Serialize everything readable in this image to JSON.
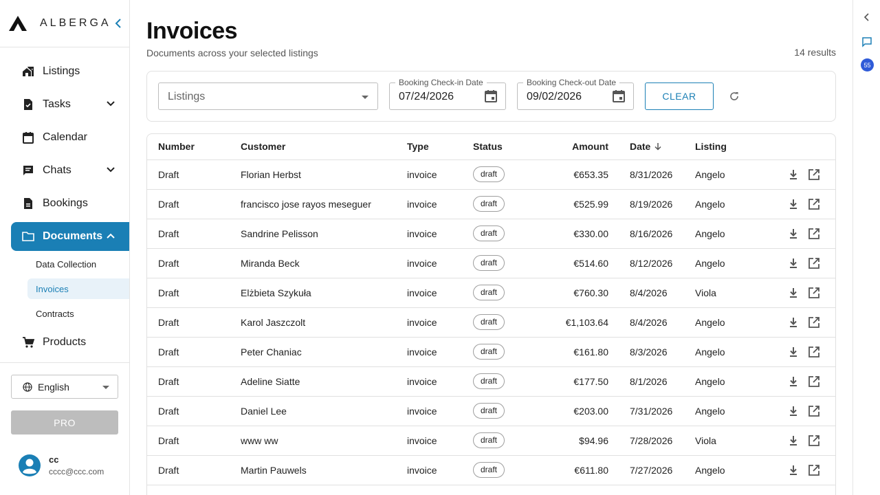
{
  "brand": {
    "name": "ALBERGA"
  },
  "sidebar": {
    "items": [
      {
        "label": "Listings",
        "icon": "home-work-icon"
      },
      {
        "label": "Tasks",
        "icon": "task-icon"
      },
      {
        "label": "Calendar",
        "icon": "calendar-icon"
      },
      {
        "label": "Chats",
        "icon": "chat-icon"
      },
      {
        "label": "Bookings",
        "icon": "document-icon"
      },
      {
        "label": "Documents",
        "icon": "folder-icon",
        "active": true
      },
      {
        "label": "Products",
        "icon": "cart-icon"
      }
    ],
    "documents_sub": [
      {
        "label": "Data Collection"
      },
      {
        "label": "Invoices",
        "active": true
      },
      {
        "label": "Contracts"
      }
    ],
    "language": "English",
    "pro_label": "PRO",
    "user": {
      "name": "cc",
      "email": "cccc@ccc.com"
    }
  },
  "page": {
    "title": "Invoices",
    "subtitle": "Documents across your selected listings",
    "results": "14 results"
  },
  "filters": {
    "listings_placeholder": "Listings",
    "checkin_label": "Booking Check-in Date",
    "checkin_value": "07/24/2026",
    "checkout_label": "Booking Check-out Date",
    "checkout_value": "09/02/2026",
    "clear_label": "CLEAR"
  },
  "table": {
    "headers": {
      "number": "Number",
      "customer": "Customer",
      "type": "Type",
      "status": "Status",
      "amount": "Amount",
      "date": "Date",
      "listing": "Listing"
    },
    "rows": [
      {
        "number": "Draft",
        "customer": "Florian Herbst",
        "type": "invoice",
        "status": "draft",
        "amount": "€653.35",
        "date": "8/31/2026",
        "listing": "Angelo"
      },
      {
        "number": "Draft",
        "customer": "francisco jose rayos meseguer",
        "type": "invoice",
        "status": "draft",
        "amount": "€525.99",
        "date": "8/19/2026",
        "listing": "Angelo"
      },
      {
        "number": "Draft",
        "customer": "Sandrine Pelisson",
        "type": "invoice",
        "status": "draft",
        "amount": "€330.00",
        "date": "8/16/2026",
        "listing": "Angelo"
      },
      {
        "number": "Draft",
        "customer": "Miranda Beck",
        "type": "invoice",
        "status": "draft",
        "amount": "€514.60",
        "date": "8/12/2026",
        "listing": "Angelo"
      },
      {
        "number": "Draft",
        "customer": "Elżbieta Szykuła",
        "type": "invoice",
        "status": "draft",
        "amount": "€760.30",
        "date": "8/4/2026",
        "listing": "Viola"
      },
      {
        "number": "Draft",
        "customer": "Karol Jaszczolt",
        "type": "invoice",
        "status": "draft",
        "amount": "€1,103.64",
        "date": "8/4/2026",
        "listing": "Angelo"
      },
      {
        "number": "Draft",
        "customer": "Peter Chaniac",
        "type": "invoice",
        "status": "draft",
        "amount": "€161.80",
        "date": "8/3/2026",
        "listing": "Angelo"
      },
      {
        "number": "Draft",
        "customer": "Adeline Siatte",
        "type": "invoice",
        "status": "draft",
        "amount": "€177.50",
        "date": "8/1/2026",
        "listing": "Angelo"
      },
      {
        "number": "Draft",
        "customer": "Daniel Lee",
        "type": "invoice",
        "status": "draft",
        "amount": "€203.00",
        "date": "7/31/2026",
        "listing": "Angelo"
      },
      {
        "number": "Draft",
        "customer": "www ww",
        "type": "invoice",
        "status": "draft",
        "amount": "$94.96",
        "date": "7/28/2026",
        "listing": "Viola"
      },
      {
        "number": "Draft",
        "customer": "Martin Pauwels",
        "type": "invoice",
        "status": "draft",
        "amount": "€611.80",
        "date": "7/27/2026",
        "listing": "Angelo"
      }
    ]
  },
  "rail": {
    "badge_count": "55"
  },
  "colors": {
    "accent": "#1a7fb5",
    "badge_blue": "#2f5bd8",
    "pro_disabled": "#bdbdbd"
  }
}
